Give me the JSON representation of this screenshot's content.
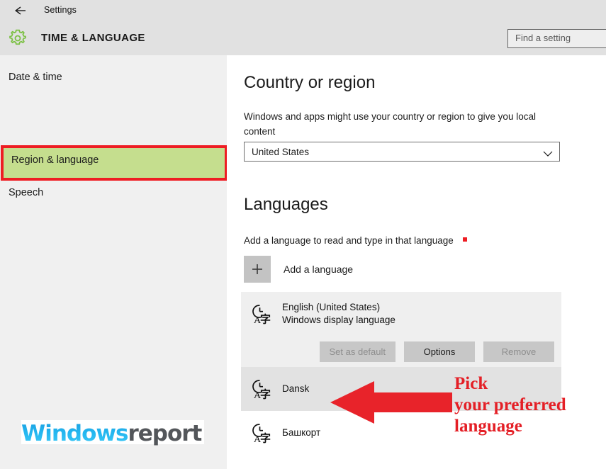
{
  "window": {
    "back_icon": "back-arrow-icon",
    "title": "Settings"
  },
  "header": {
    "icon": "gear-icon",
    "icon_color": "#7bc043",
    "category": "TIME & LANGUAGE",
    "search_placeholder": "Find a setting",
    "search_value": ""
  },
  "sidebar": {
    "items": [
      {
        "label": "Date & time",
        "selected": false
      },
      {
        "label": "Region & language",
        "selected": true,
        "highlight_fill": "#c5de8e",
        "highlight_border": "#ee1d23"
      },
      {
        "label": "Speech",
        "selected": false
      }
    ]
  },
  "content": {
    "country": {
      "title": "Country or region",
      "description": "Windows and apps might use your country or region to give you local content",
      "selected_value": "United States",
      "chevron_icon": "chevron-down-icon"
    },
    "languages": {
      "title": "Languages",
      "description": "Add a language to read and type in that language",
      "add_button": {
        "icon": "plus-icon",
        "label": "Add a language"
      },
      "list": [
        {
          "icon": "language-clock-icon",
          "name": "English (United States)",
          "sub": "Windows display language",
          "state": "primary"
        },
        {
          "icon": "language-clock-icon",
          "name": "Dansk",
          "sub": "",
          "state": "selected"
        },
        {
          "icon": "language-clock-icon",
          "name": "Башкорт",
          "sub": "",
          "state": "plain"
        }
      ],
      "actions": [
        {
          "label": "Set as default",
          "enabled": false
        },
        {
          "label": "Options",
          "enabled": true
        },
        {
          "label": "Remove",
          "enabled": false
        }
      ]
    }
  },
  "annotations": {
    "arrow": {
      "icon": "left-arrow-annotation-icon",
      "color": "#e8232a"
    },
    "callout_line1": "Pick",
    "callout_line2": "your preferred",
    "callout_line3": "language",
    "callout_color": "#e41f26"
  },
  "watermark": {
    "part_a": "Windows",
    "part_b": "report"
  }
}
